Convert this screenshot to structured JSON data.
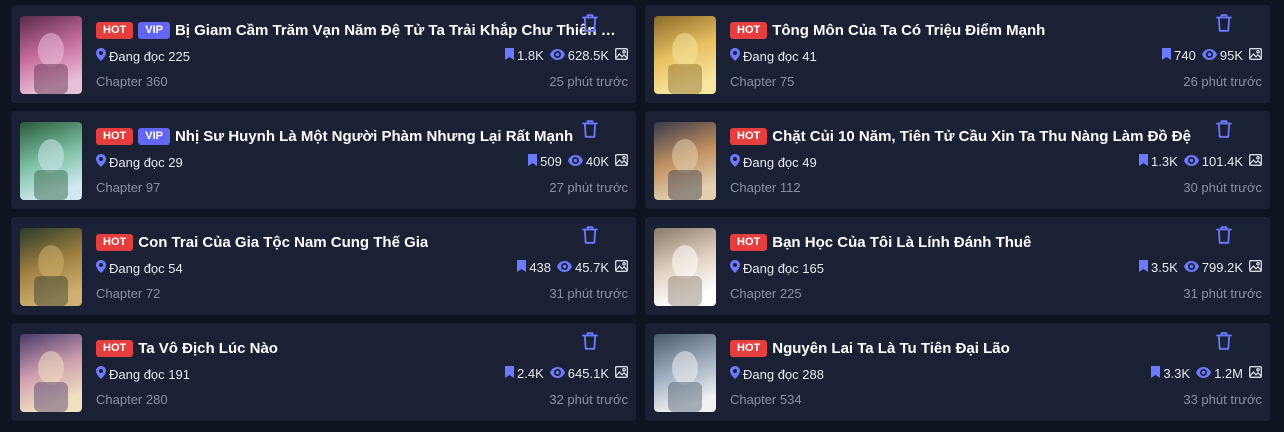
{
  "badges": {
    "hot": "HOT",
    "vip": "VIP"
  },
  "colors": {
    "background": "#0f1421",
    "card": "#1a2135",
    "hot": "#e53e3e",
    "vip": "#6366f1",
    "accent": "#6b7aff",
    "muted": "#8a91a5"
  },
  "icons": {
    "reading": "location-pin-icon",
    "bookmark": "bookmark-icon",
    "views": "eye-icon",
    "image": "image-icon",
    "delete": "trash-icon"
  },
  "items": [
    {
      "title": "Bị Giam Cầm Trăm Vạn Năm Đệ Tử Ta Trải Khắp Chư Thiên Thầ...",
      "hot": true,
      "vip": true,
      "reading": "Đang đọc 225",
      "bookmarks": "1.8K",
      "views": "628.5K",
      "chapter": "Chapter 360",
      "time": "25 phút trước",
      "cover": [
        "#5a2a4a",
        "#c86fa0",
        "#e8c0d8"
      ]
    },
    {
      "title": "Tông Môn Của Ta Có Triệu Điểm Mạnh",
      "hot": true,
      "vip": false,
      "reading": "Đang đọc 41",
      "bookmarks": "740",
      "views": "95K",
      "chapter": "Chapter 75",
      "time": "26 phút trước",
      "cover": [
        "#8a6a2a",
        "#e8c060",
        "#f6e6a0"
      ]
    },
    {
      "title": "Nhị Sư Huynh Là Một Người Phàm Nhưng Lại Rất Mạnh",
      "hot": true,
      "vip": true,
      "reading": "Đang đọc 29",
      "bookmarks": "509",
      "views": "40K",
      "chapter": "Chapter 97",
      "time": "27 phút trước",
      "cover": [
        "#2a5a3a",
        "#7ac0a0",
        "#d0e8f0"
      ]
    },
    {
      "title": "Chặt Củi 10 Năm, Tiên Tử Cầu Xin Ta Thu Nàng Làm Đồ Đệ",
      "hot": true,
      "vip": false,
      "reading": "Đang đọc 49",
      "bookmarks": "1.3K",
      "views": "101.4K",
      "chapter": "Chapter 112",
      "time": "30 phút trước",
      "cover": [
        "#3a3a4a",
        "#c09060",
        "#e0d0b0"
      ]
    },
    {
      "title": "Con Trai Của Gia Tộc Nam Cung Thế Gia",
      "hot": true,
      "vip": false,
      "reading": "Đang đọc 54",
      "bookmarks": "438",
      "views": "45.7K",
      "chapter": "Chapter 72",
      "time": "31 phút trước",
      "cover": [
        "#2a3a2a",
        "#a08040",
        "#d0b070"
      ]
    },
    {
      "title": "Bạn Học Của Tôi Là Lính Đánh Thuê",
      "hot": true,
      "vip": false,
      "reading": "Đang đọc 165",
      "bookmarks": "3.5K",
      "views": "799.2K",
      "chapter": "Chapter 225",
      "time": "31 phút trước",
      "cover": [
        "#8a7a6a",
        "#e0d0c0",
        "#ffffff"
      ]
    },
    {
      "title": "Ta Vô Địch Lúc Nào",
      "hot": true,
      "vip": false,
      "reading": "Đang đọc 191",
      "bookmarks": "2.4K",
      "views": "645.1K",
      "chapter": "Chapter 280",
      "time": "32 phút trước",
      "cover": [
        "#4a3a6a",
        "#d0a0b0",
        "#f0e0c0"
      ]
    },
    {
      "title": "Nguyên Lai Ta Là Tu Tiên Đại Lão",
      "hot": true,
      "vip": false,
      "reading": "Đang đọc 288",
      "bookmarks": "3.3K",
      "views": "1.2M",
      "chapter": "Chapter 534",
      "time": "33 phút trước",
      "cover": [
        "#4a5a6a",
        "#a0b0c0",
        "#f0f0f0"
      ]
    }
  ]
}
